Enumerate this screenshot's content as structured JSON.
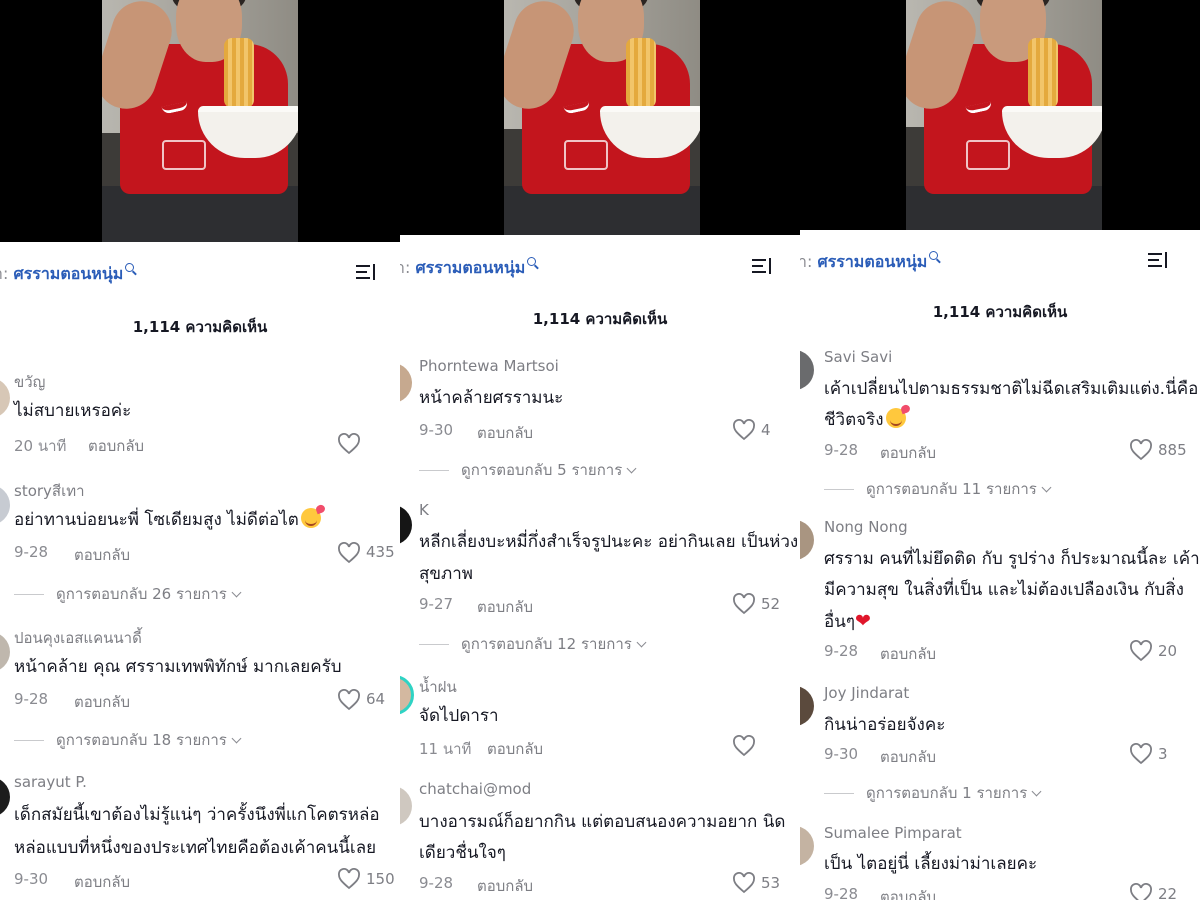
{
  "panels": [
    {
      "search_prefix": "า:",
      "search_term": "ศรรามตอนหนุ่ม",
      "comment_count": "1,114 ความคิดเห็น",
      "comments": [
        {
          "username": "ขวัญ",
          "text": [
            "ไม่สบายเหรอค่ะ"
          ],
          "time": "20 นาที",
          "reply": "ตอบกลับ",
          "likes": "",
          "view_replies": ""
        },
        {
          "username": "storyสีเทา",
          "text": [
            "อย่าทานบ่อยนะพี่ โซเดียมสูง ไม่ดีต่อไต"
          ],
          "time": "9-28",
          "reply": "ตอบกลับ",
          "likes": "435",
          "view_replies": "ดูการตอบกลับ 26 รายการ"
        },
        {
          "username": "ปอนคุงเอสแคนนาดี้",
          "text": [
            "หน้าคล้าย คุณ ศรรามเทพพิทักษ์ มากเลยครับ"
          ],
          "time": "9-28",
          "reply": "ตอบกลับ",
          "likes": "64",
          "view_replies": "ดูการตอบกลับ 18 รายการ"
        },
        {
          "username": "sarayut P.",
          "text": [
            "เด็กสมัยนี้เขาต้องไม่รู้แน่ๆ ว่าครั้งนึงพี่แกโคตรหล่อ",
            "หล่อแบบที่หนึ่งของประเทศไทยคือต้องเค้าคนนี้เลย"
          ],
          "time": "9-30",
          "reply": "ตอบกลับ",
          "likes": "150",
          "view_replies": ""
        }
      ]
    },
    {
      "search_prefix": "า:",
      "search_term": "ศรรามตอนหนุ่ม",
      "comment_count": "1,114 ความคิดเห็น",
      "comments": [
        {
          "username": "Phorntewa Martsoi",
          "text": [
            "หน้าคล้ายศรรามนะ"
          ],
          "time": "9-30",
          "reply": "ตอบกลับ",
          "likes": "4",
          "view_replies": "ดูการตอบกลับ 5 รายการ"
        },
        {
          "username": "K",
          "text": [
            "หลีกเลี่ยงบะหมี่กึ่งสำเร็จรูปนะคะ อย่ากินเลย เป็นห่วง",
            "สุขภาพ"
          ],
          "time": "9-27",
          "reply": "ตอบกลับ",
          "likes": "52",
          "view_replies": "ดูการตอบกลับ 12 รายการ"
        },
        {
          "username": "น้ำฝน",
          "text": [
            "จัดไปดารา"
          ],
          "time": "11 นาที",
          "reply": "ตอบกลับ",
          "likes": "",
          "view_replies": ""
        },
        {
          "username": "chatchai@mod",
          "text": [
            "บางอารมณ์ก็อยากกิน แต่ตอบสนองความอยาก นิด",
            "เดียวชื่นใจๆ"
          ],
          "time": "9-28",
          "reply": "ตอบกลับ",
          "likes": "53",
          "view_replies": ""
        }
      ]
    },
    {
      "search_prefix": "า:",
      "search_term": "ศรรามตอนหนุ่ม",
      "comment_count": "1,114 ความคิดเห็น",
      "comments": [
        {
          "username": "Savi  Savi",
          "text": [
            "เค้าเปลี่ยนไปตามธรรมชาติไม่ฉีดเสริมเติมแต่ง.นี่คือ",
            "ชีวิตจริง"
          ],
          "time": "9-28",
          "reply": "ตอบกลับ",
          "likes": "885",
          "view_replies": "ดูการตอบกลับ 11 รายการ"
        },
        {
          "username": "Nong Nong",
          "text": [
            "ศรราม คนที่ไม่ยึดติด กับ รูปร่าง ก็ประมาณนี้ละ เค้า",
            "มีความสุข ในสิ่งที่เป็น และไม่ต้องเปลืองเงิน กับสิ่ง",
            "อื่นๆ"
          ],
          "time": "9-28",
          "reply": "ตอบกลับ",
          "likes": "20",
          "view_replies": ""
        },
        {
          "username": "Joy Jindarat",
          "text": [
            "กินน่าอร่อยจังคะ"
          ],
          "time": "9-30",
          "reply": "ตอบกลับ",
          "likes": "3",
          "view_replies": "ดูการตอบกลับ 1 รายการ"
        },
        {
          "username": "Sumalee Pimparat",
          "text": [
            "เป็น ไตอยู่นี่ เลี้ยงม่าม่าเลยคะ"
          ],
          "time": "9-28",
          "reply": "ตอบกลับ",
          "likes": "22",
          "view_replies": ""
        }
      ]
    }
  ],
  "icons": {
    "search": "search-icon",
    "sort": "sort-icon",
    "like": "heart-outline-icon"
  },
  "colors": {
    "link": "#2b5db8",
    "text": "#161823",
    "muted": "#8a8b91",
    "shirt": "#c3151d"
  }
}
